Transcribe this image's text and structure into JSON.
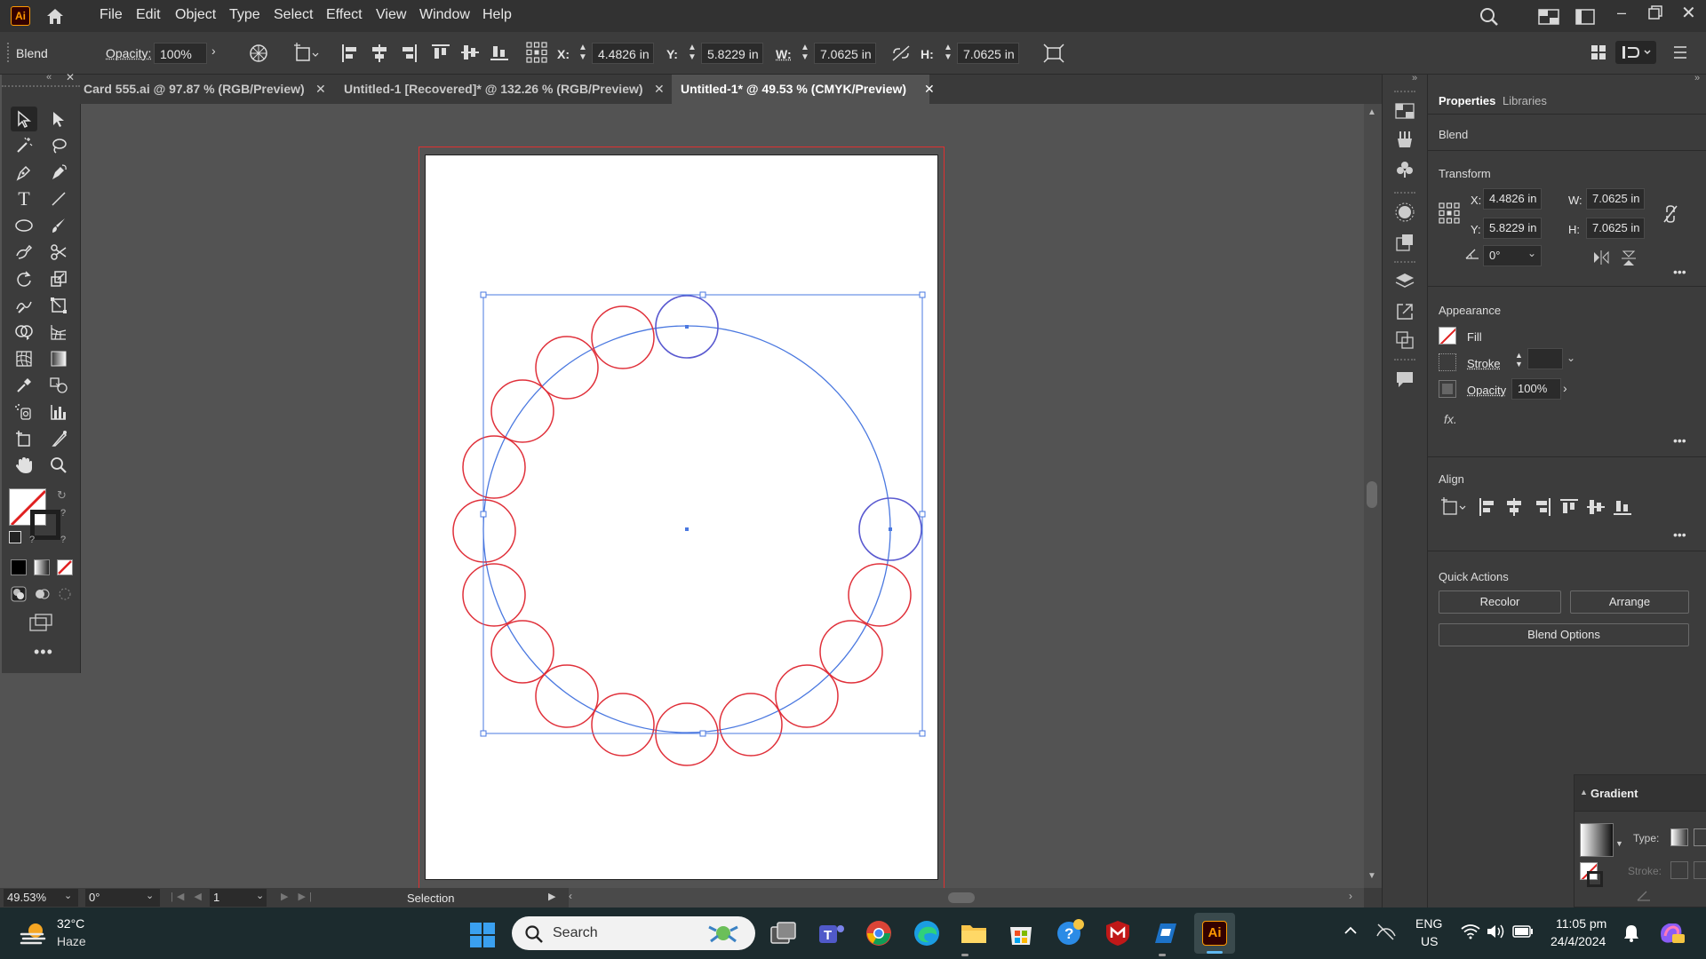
{
  "menubar": {
    "app_icon": "Ai",
    "items": [
      "File",
      "Edit",
      "Object",
      "Type",
      "Select",
      "Effect",
      "View",
      "Window",
      "Help"
    ]
  },
  "control": {
    "mode_label": "Blend",
    "opacity_label": "Opacity:",
    "opacity_value": "100%",
    "x_label": "X:",
    "x_value": "4.4826 in",
    "y_label": "Y:",
    "y_value": "5.8229 in",
    "w_label": "W:",
    "w_value": "7.0625 in",
    "h_label": "H:",
    "h_value": "7.0625 in"
  },
  "tabs": [
    {
      "label": "Card 555.ai @ 97.87 % (RGB/Preview)",
      "active": false
    },
    {
      "label": "Untitled-1 [Recovered]* @ 132.26 % (RGB/Preview)",
      "active": false
    },
    {
      "label": "Untitled-1* @ 49.53 % (CMYK/Preview)",
      "active": true
    }
  ],
  "properties": {
    "tab_properties": "Properties",
    "tab_libraries": "Libraries",
    "object_type": "Blend",
    "transform_title": "Transform",
    "x_label": "X:",
    "x_value": "4.4826 in",
    "y_label": "Y:",
    "y_value": "5.8229 in",
    "w_label": "W:",
    "w_value": "7.0625 in",
    "h_label": "H:",
    "h_value": "7.0625 in",
    "angle_value": "0°",
    "appearance_title": "Appearance",
    "fill_label": "Fill",
    "stroke_label": "Stroke",
    "opacity_label": "Opacity",
    "opacity_value": "100%",
    "fx_label": "fx.",
    "align_title": "Align",
    "quick_actions_title": "Quick Actions",
    "recolor_label": "Recolor",
    "arrange_label": "Arrange",
    "blend_options_label": "Blend Options"
  },
  "gradient_panel": {
    "title": "Gradient",
    "type_label": "Type:",
    "stroke_label": "Stroke:"
  },
  "status": {
    "zoom": "49.53%",
    "rotation": "0°",
    "artboard": "1",
    "tool": "Selection"
  },
  "taskbar": {
    "temperature": "32°C",
    "weather": "Haze",
    "search_placeholder": "Search",
    "lang_top": "ENG",
    "lang_bottom": "US",
    "time": "11:05 pm",
    "date": "24/4/2024"
  },
  "colors": {
    "accent_selection": "#4a78e0",
    "circle_stroke": "#e0303a",
    "artboard_bleed": "#e03030"
  }
}
